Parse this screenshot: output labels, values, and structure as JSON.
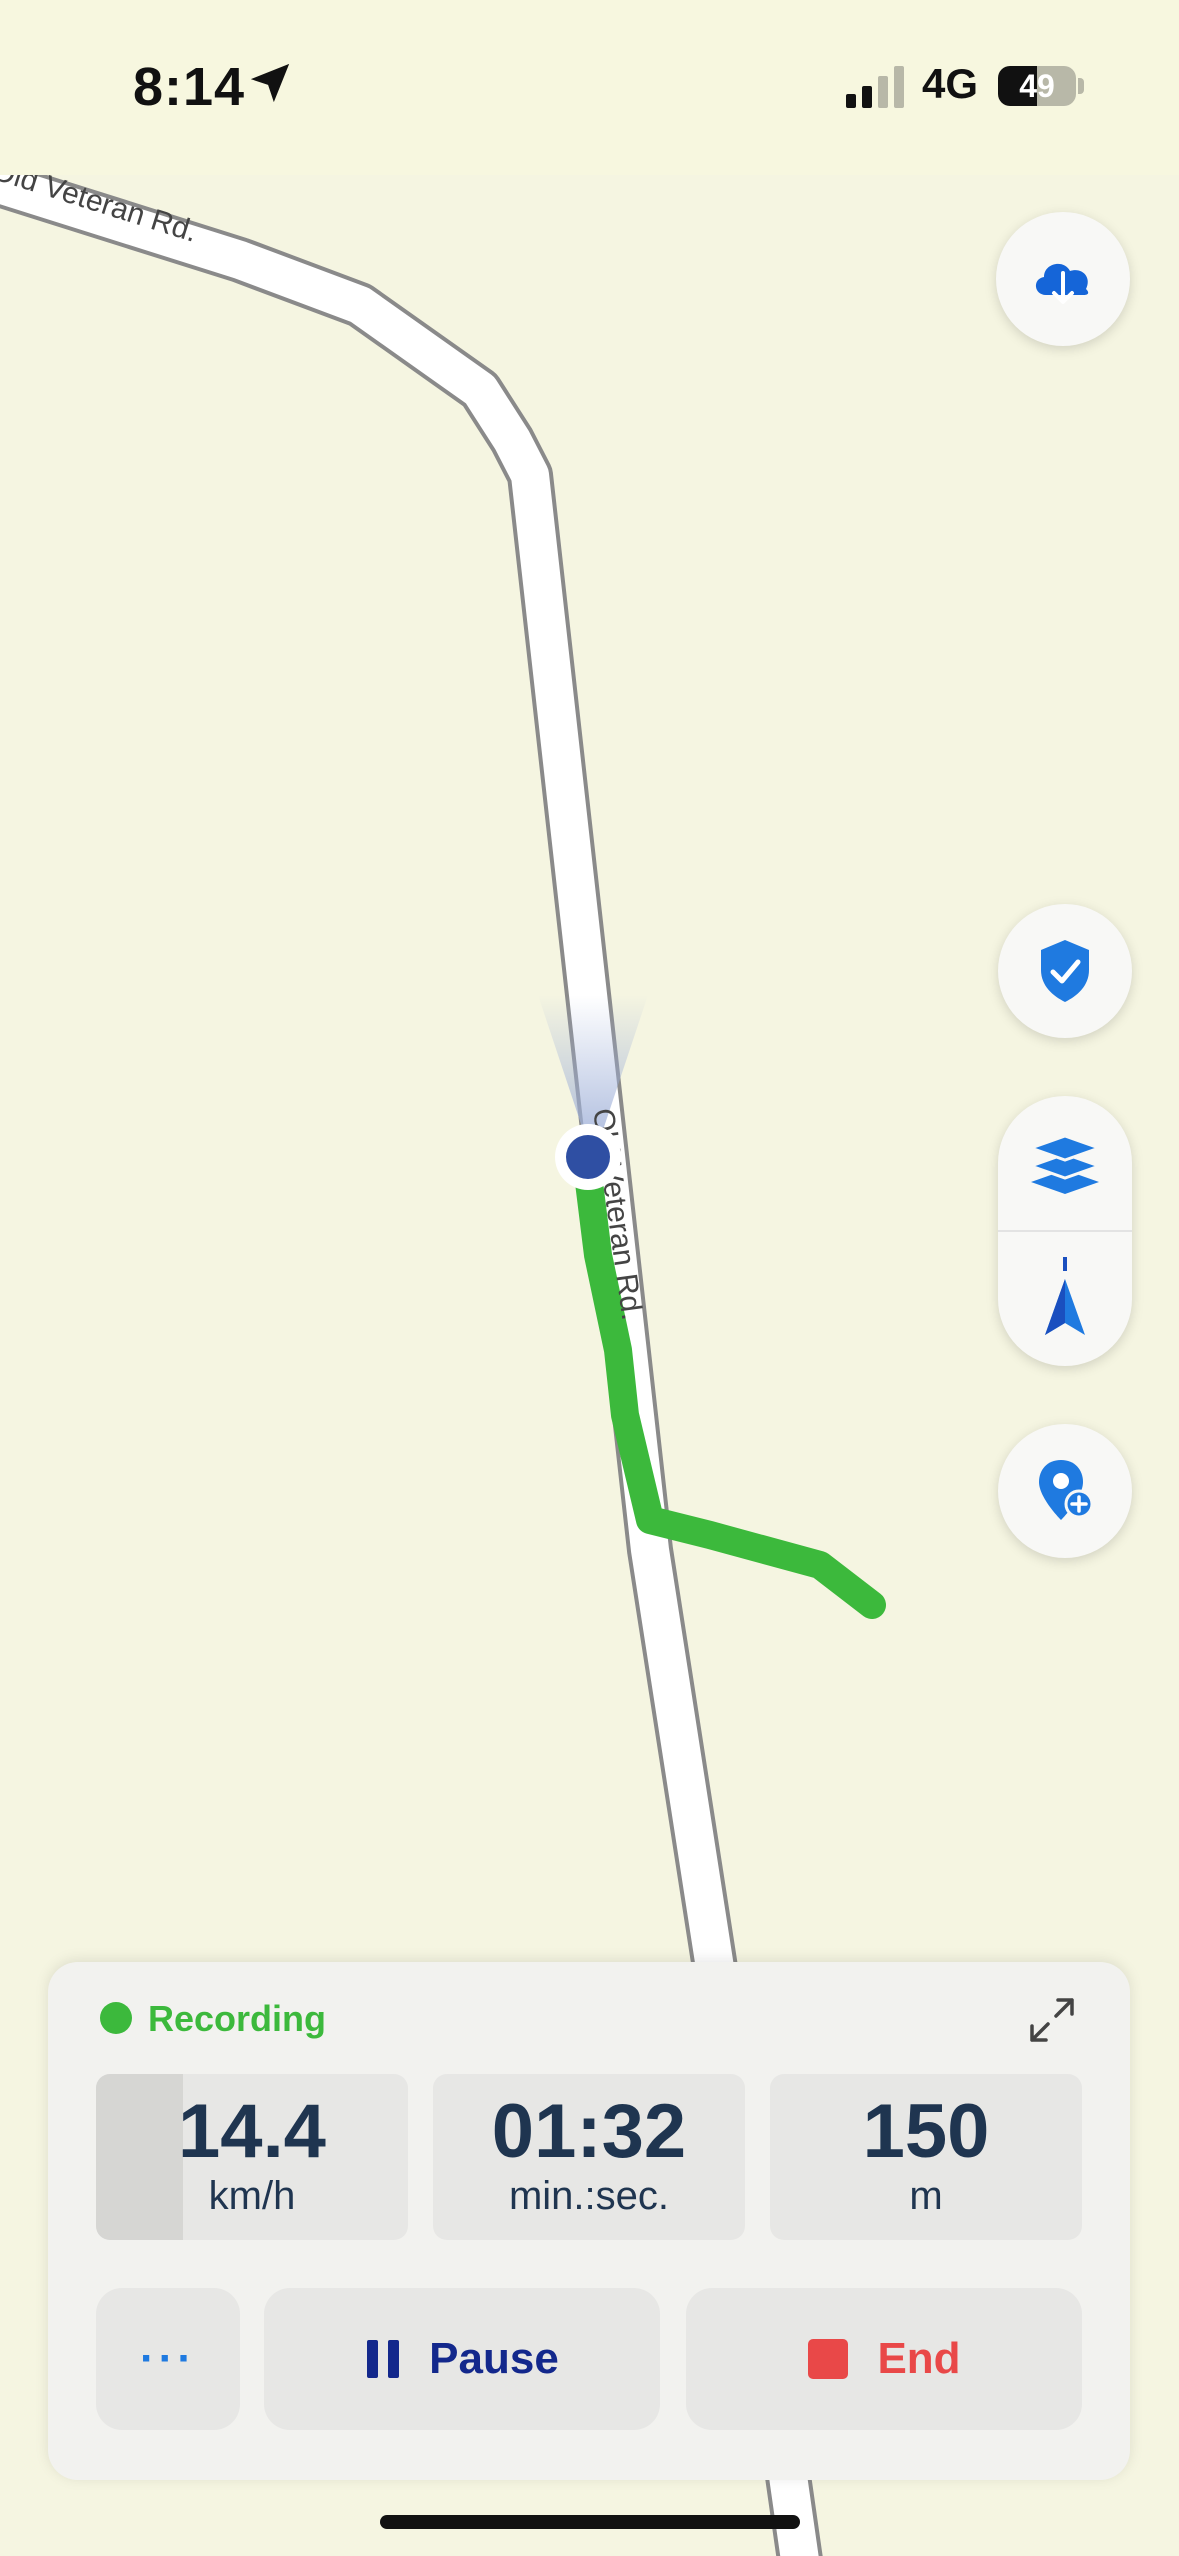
{
  "status_bar": {
    "time": "8:14",
    "network": "4G",
    "battery": "49",
    "icons": [
      "location-arrow-icon",
      "cellular-signal-icon",
      "battery-icon"
    ]
  },
  "map": {
    "road_labels": [
      "Old Veteran Rd.",
      "Old Veteran Rd."
    ],
    "colors": {
      "land": "#f5f5e1",
      "road": "#ffffff",
      "road_edge": "#8a8a8a",
      "track": "#3cb93c",
      "position": "#2f4fa3"
    }
  },
  "map_controls": {
    "download": "cloud-download-icon",
    "safety": "shield-check-icon",
    "layers": "layers-icon",
    "compass": "north-arrow-icon",
    "add_place": "add-location-pin-icon"
  },
  "recording": {
    "status": "Recording",
    "status_color": "#3cb93c",
    "stats": [
      {
        "value": "14.4",
        "unit": "km/h"
      },
      {
        "value": "01:32",
        "unit": "min.:sec."
      },
      {
        "value": "150",
        "unit": "m"
      }
    ],
    "speed_gauge_fraction": 0.28,
    "buttons": {
      "more": "···",
      "pause": "Pause",
      "end": "End"
    },
    "colors": {
      "pause": "#13288c",
      "end": "#e94848"
    }
  }
}
